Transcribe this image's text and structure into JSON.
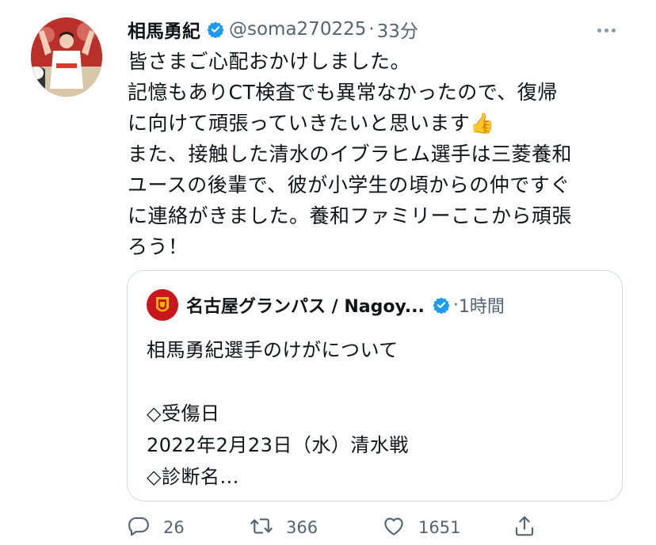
{
  "tweet": {
    "author_name": "相馬勇紀",
    "author_handle": "@soma270225",
    "separator": "·",
    "time": "33分",
    "text_lines": [
      "皆さまご心配おかけしました。",
      "記憶もありCT検査でも異常なかったので、復帰",
      "に向けて頑張っていきたいと思います👍",
      "また、接触した清水のイブラヒム選手は三菱養和",
      "ユースの後輩で、彼が小学生の頃からの仲ですぐ",
      "に連絡がきました。養和ファミリーここから頑張",
      "ろう！"
    ]
  },
  "quote": {
    "author_name": "名古屋グランパス / Nagoy...",
    "separator": "·",
    "time": "1時間",
    "text_lines": [
      "相馬勇紀選手のけがについて",
      "",
      "◇受傷日",
      "2022年2月23日（水）清水戦",
      "◇診断名..."
    ]
  },
  "actions": {
    "reply_count": "26",
    "retweet_count": "366",
    "like_count": "1651"
  },
  "colors": {
    "verified": "#1d9bf0",
    "secondary_text": "#536471",
    "border": "#cfd9de",
    "icon": "#536471"
  },
  "icons": [
    "verified-badge-icon",
    "more-icon",
    "reply-icon",
    "retweet-icon",
    "like-icon",
    "share-icon"
  ]
}
